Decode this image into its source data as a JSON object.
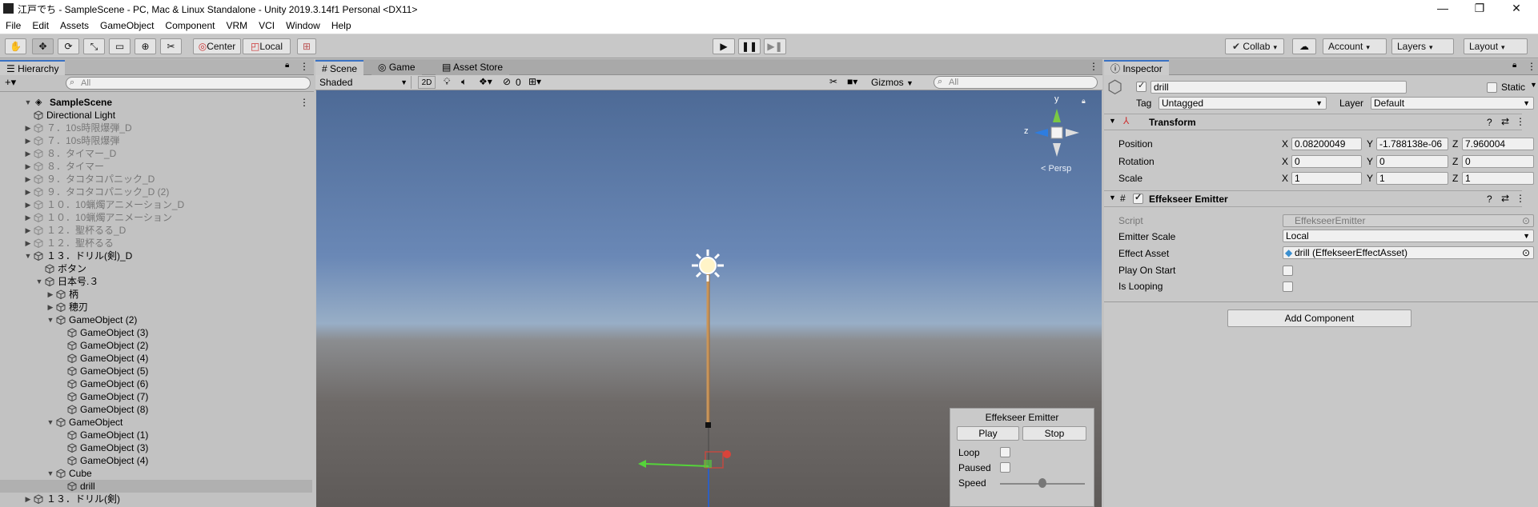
{
  "window": {
    "title": "江戸でち - SampleScene - PC, Mac & Linux Standalone - Unity 2019.3.14f1 Personal <DX11>",
    "minimize": "—",
    "maximize": "❐",
    "close": "✕"
  },
  "menu": [
    "File",
    "Edit",
    "Assets",
    "GameObject",
    "Component",
    "VRM",
    "VCI",
    "Window",
    "Help"
  ],
  "toolbar": {
    "pivot_label": "Center",
    "space_label": "Local",
    "collab_label": "Collab",
    "account_label": "Account",
    "layers_label": "Layers",
    "layout_label": "Layout"
  },
  "hierarchy": {
    "tab_label": "Hierarchy",
    "search_placeholder": "All",
    "scene_name": "SampleScene",
    "rows": [
      {
        "label": "Directional Light",
        "depth": 1,
        "arrow": "",
        "dim": false
      },
      {
        "label": "７．10s時限爆弾_D",
        "depth": 1,
        "arrow": "▶",
        "dim": true
      },
      {
        "label": "７．10s時限爆弾",
        "depth": 1,
        "arrow": "▶",
        "dim": true
      },
      {
        "label": "８．タイマー_D",
        "depth": 1,
        "arrow": "▶",
        "dim": true
      },
      {
        "label": "８．タイマー",
        "depth": 1,
        "arrow": "▶",
        "dim": true
      },
      {
        "label": "９．タコタコパニック_D",
        "depth": 1,
        "arrow": "▶",
        "dim": true
      },
      {
        "label": "９．タコタコパニック_D (2)",
        "depth": 1,
        "arrow": "▶",
        "dim": true
      },
      {
        "label": "１０．10蝋燭アニメーション_D",
        "depth": 1,
        "arrow": "▶",
        "dim": true
      },
      {
        "label": "１０．10蝋燭アニメーション",
        "depth": 1,
        "arrow": "▶",
        "dim": true
      },
      {
        "label": "１２．聖杯るる_D",
        "depth": 1,
        "arrow": "▶",
        "dim": true
      },
      {
        "label": "１２．聖杯るる",
        "depth": 1,
        "arrow": "▶",
        "dim": true
      },
      {
        "label": "１３．ドリル(剣)_D",
        "depth": 1,
        "arrow": "▼",
        "dim": false
      },
      {
        "label": "ボタン",
        "depth": 2,
        "arrow": "",
        "dim": false
      },
      {
        "label": "日本号.３",
        "depth": 2,
        "arrow": "▼",
        "dim": false
      },
      {
        "label": "柄",
        "depth": 3,
        "arrow": "▶",
        "dim": false
      },
      {
        "label": "穂刃",
        "depth": 3,
        "arrow": "▶",
        "dim": false
      },
      {
        "label": "GameObject (2)",
        "depth": 3,
        "arrow": "▼",
        "dim": false
      },
      {
        "label": "GameObject (3)",
        "depth": 4,
        "arrow": "",
        "dim": false
      },
      {
        "label": "GameObject (2)",
        "depth": 4,
        "arrow": "",
        "dim": false
      },
      {
        "label": "GameObject (4)",
        "depth": 4,
        "arrow": "",
        "dim": false
      },
      {
        "label": "GameObject (5)",
        "depth": 4,
        "arrow": "",
        "dim": false
      },
      {
        "label": "GameObject (6)",
        "depth": 4,
        "arrow": "",
        "dim": false
      },
      {
        "label": "GameObject (7)",
        "depth": 4,
        "arrow": "",
        "dim": false
      },
      {
        "label": "GameObject (8)",
        "depth": 4,
        "arrow": "",
        "dim": false
      },
      {
        "label": "GameObject",
        "depth": 3,
        "arrow": "▼",
        "dim": false
      },
      {
        "label": "GameObject (1)",
        "depth": 4,
        "arrow": "",
        "dim": false
      },
      {
        "label": "GameObject (3)",
        "depth": 4,
        "arrow": "",
        "dim": false
      },
      {
        "label": "GameObject (4)",
        "depth": 4,
        "arrow": "",
        "dim": false
      },
      {
        "label": "Cube",
        "depth": 3,
        "arrow": "▼",
        "dim": false
      },
      {
        "label": "drill",
        "depth": 4,
        "arrow": "",
        "dim": false,
        "selected": true
      },
      {
        "label": "１３．ドリル(剣)",
        "depth": 1,
        "arrow": "▶",
        "dim": false
      }
    ]
  },
  "scene": {
    "tabs": [
      "Scene",
      "Game",
      "Asset Store"
    ],
    "shading_mode": "Shaded",
    "mode_2d": "2D",
    "hidden_count": "0",
    "gizmos_label": "Gizmos",
    "search_placeholder": "All",
    "persp_label": "< Persp",
    "axis_y": "y",
    "axis_z": "z"
  },
  "emitter_overlay": {
    "title": "Effekseer Emitter",
    "play_label": "Play",
    "stop_label": "Stop",
    "loop_label": "Loop",
    "paused_label": "Paused",
    "speed_label": "Speed",
    "speed_fraction": 0.5
  },
  "inspector": {
    "tab_label": "Inspector",
    "object_name": "drill",
    "static_label": "Static",
    "tag_label": "Tag",
    "tag_value": "Untagged",
    "layer_label": "Layer",
    "layer_value": "Default",
    "transform": {
      "title": "Transform",
      "position_label": "Position",
      "px": "0.08200049",
      "py": "-1.788138e-06",
      "pz": "7.960004",
      "rotation_label": "Rotation",
      "rx": "0",
      "ry": "0",
      "rz": "0",
      "scale_label": "Scale",
      "sx": "1",
      "sy": "1",
      "sz": "1",
      "x": "X",
      "y": "Y",
      "z": "Z"
    },
    "emitter": {
      "title": "Effekseer Emitter",
      "script_label": "Script",
      "script_value": "EffekseerEmitter",
      "scale_label": "Emitter Scale",
      "scale_value": "Local",
      "asset_label": "Effect Asset",
      "asset_value": "drill (EffekseerEffectAsset)",
      "playonstart_label": "Play On Start",
      "looping_label": "Is Looping"
    },
    "add_component_label": "Add Component"
  }
}
